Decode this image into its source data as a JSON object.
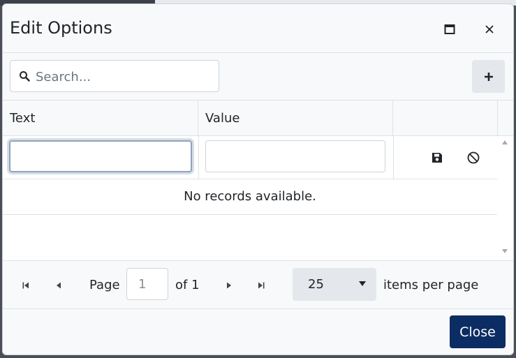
{
  "dialog": {
    "title": "Edit Options",
    "icons": {
      "maximize": "maximize-icon",
      "close": "close-icon"
    }
  },
  "toolbar": {
    "search_placeholder": "Search...",
    "search_icon": "search-icon",
    "add_icon": "plus-icon"
  },
  "grid": {
    "columns": [
      {
        "label": "Text"
      },
      {
        "label": "Value"
      },
      {
        "label": ""
      }
    ],
    "edit_row": {
      "text_value": "",
      "value_value": "",
      "save_icon": "save-icon",
      "cancel_icon": "cancel-icon"
    },
    "no_records": "No records available."
  },
  "pager": {
    "page_label": "Page",
    "page_value": "1",
    "of_label": "of 1",
    "page_size": "25",
    "items_per_page_label": "items per page"
  },
  "footer": {
    "close_label": "Close"
  },
  "colors": {
    "primary": "#0b2d63",
    "focus_border": "#8fa3bf",
    "secondary_button": "#e4e7eb"
  }
}
